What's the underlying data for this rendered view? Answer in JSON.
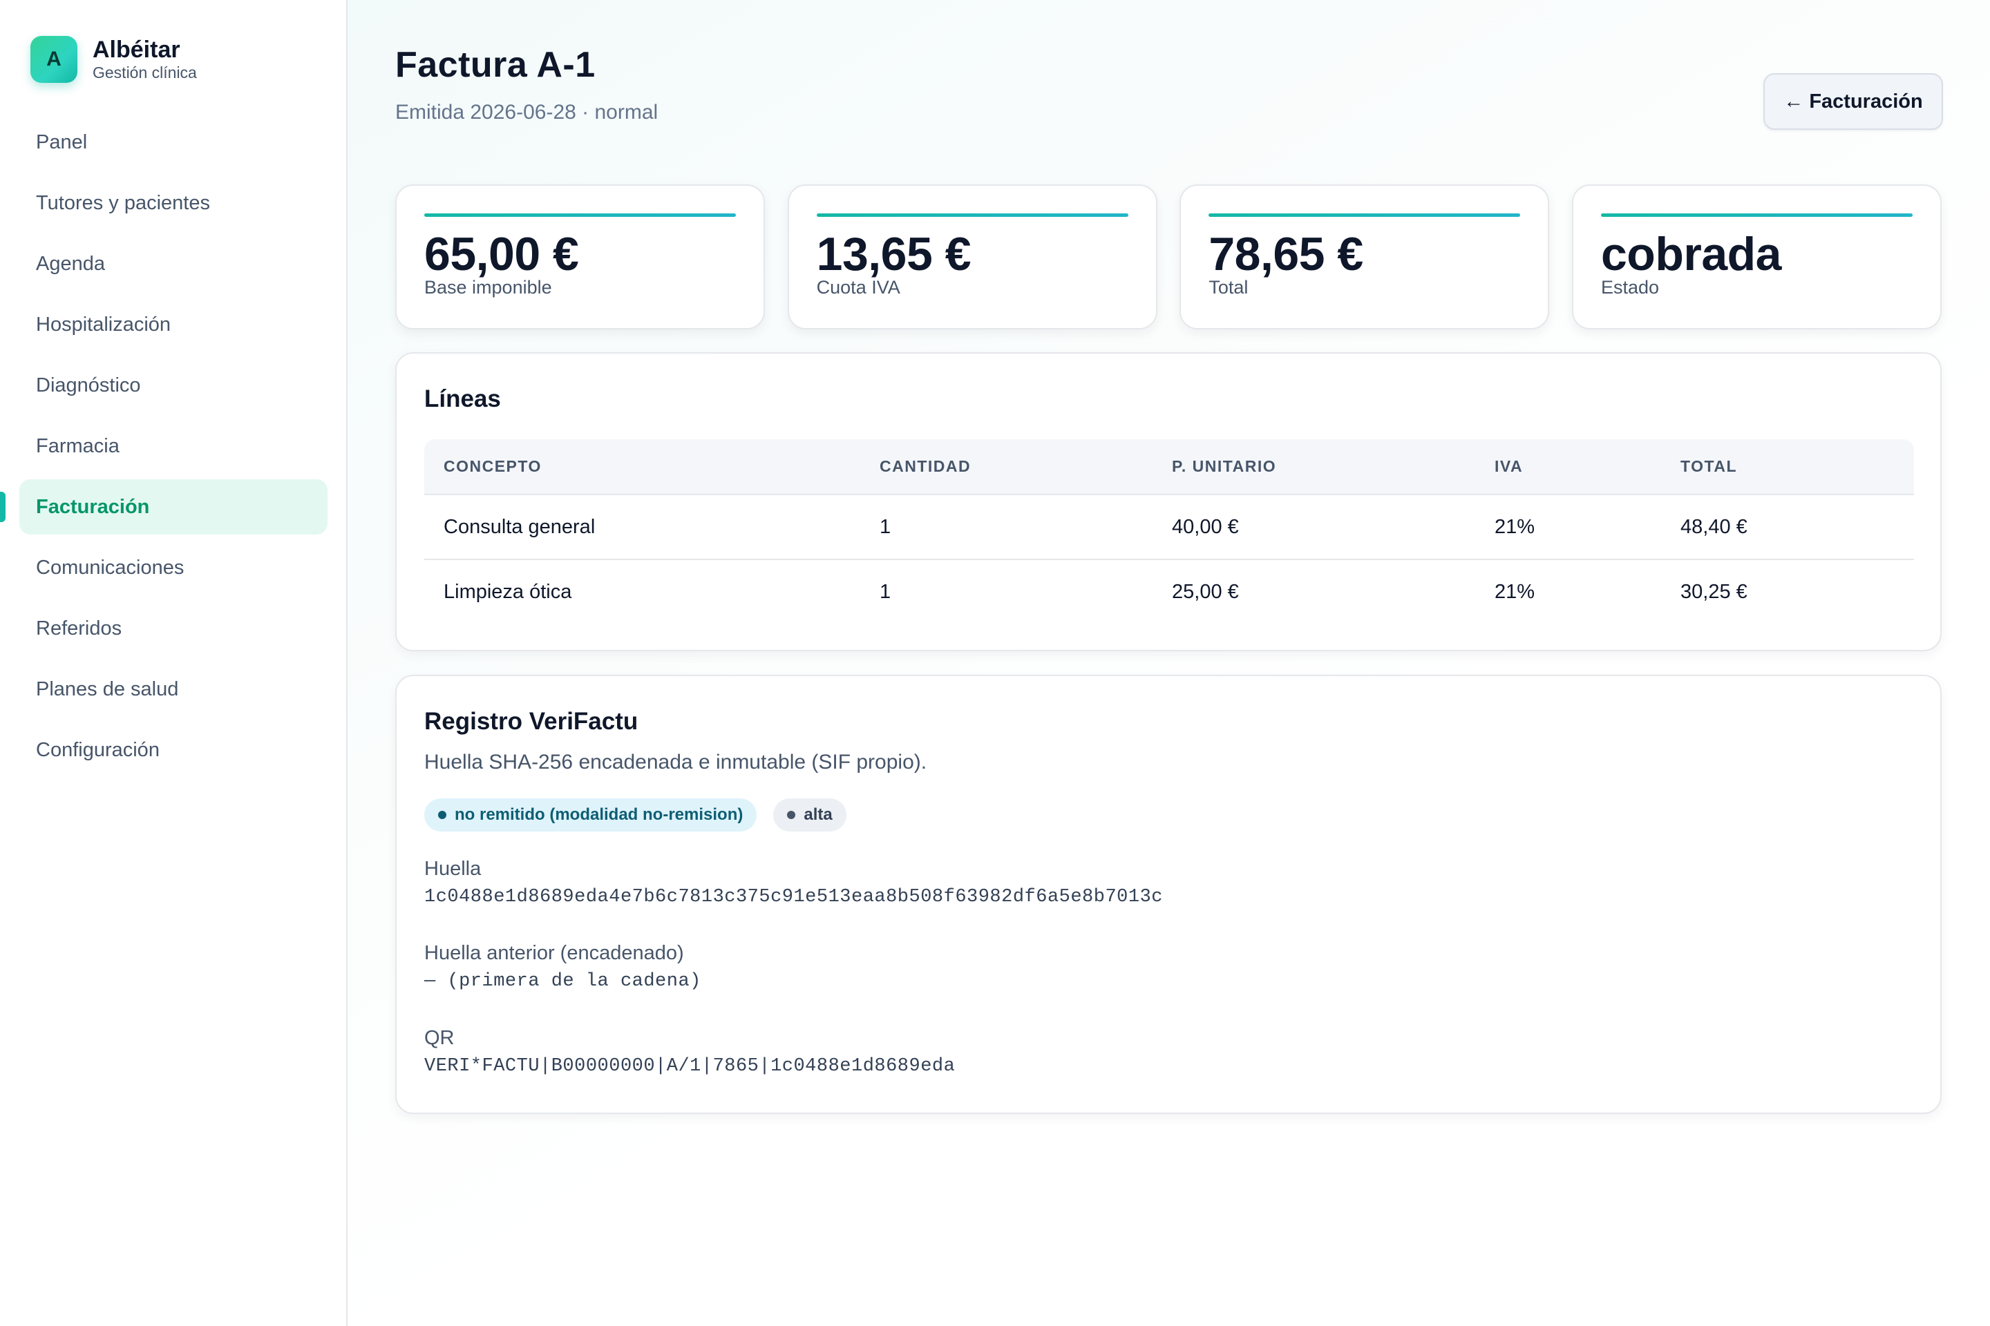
{
  "brand": {
    "logo_letter": "A",
    "name": "Albéitar",
    "subtitle": "Gestión clínica"
  },
  "sidebar": {
    "active_index": 6,
    "items": [
      {
        "label": "Panel"
      },
      {
        "label": "Tutores y pacientes"
      },
      {
        "label": "Agenda"
      },
      {
        "label": "Hospitalización"
      },
      {
        "label": "Diagnóstico"
      },
      {
        "label": "Farmacia"
      },
      {
        "label": "Facturación"
      },
      {
        "label": "Comunicaciones"
      },
      {
        "label": "Referidos"
      },
      {
        "label": "Planes de salud"
      },
      {
        "label": "Configuración"
      }
    ]
  },
  "header": {
    "title": "Factura A-1",
    "subtitle": "Emitida 2026-06-28 · normal",
    "back_button": "← Facturación"
  },
  "stats": [
    {
      "value": "65,00 €",
      "label": "Base imponible"
    },
    {
      "value": "13,65 €",
      "label": "Cuota IVA"
    },
    {
      "value": "78,65 €",
      "label": "Total"
    },
    {
      "value": "cobrada",
      "label": "Estado"
    }
  ],
  "lines": {
    "title": "Líneas",
    "columns": [
      "CONCEPTO",
      "CANTIDAD",
      "P. UNITARIO",
      "IVA",
      "TOTAL"
    ],
    "rows": [
      [
        "Consulta general",
        "1",
        "40,00 €",
        "21%",
        "48,40 €"
      ],
      [
        "Limpieza ótica",
        "1",
        "25,00 €",
        "21%",
        "30,25 €"
      ]
    ]
  },
  "verifactu": {
    "title": "Registro VeriFactu",
    "description": "Huella SHA-256 encadenada e inmutable (SIF propio).",
    "badges": [
      "no remitido (modalidad no-remision)",
      "alta"
    ],
    "hash_label": "Huella",
    "hash_value": "1c0488e1d8689eda4e7b6c7813c375c91e513eaa8b508f63982df6a5e8b7013c",
    "prev_label": "Huella anterior (encadenado)",
    "prev_value": "— (primera de la cadena)",
    "qr_label": "QR",
    "qr_value": "VERI*FACTU|B00000000|A/1|7865|1c0488e1d8689eda"
  },
  "colors": {
    "accent": "#14b8a6",
    "active_text": "#059669",
    "active_bg": "#e3f8f1"
  }
}
